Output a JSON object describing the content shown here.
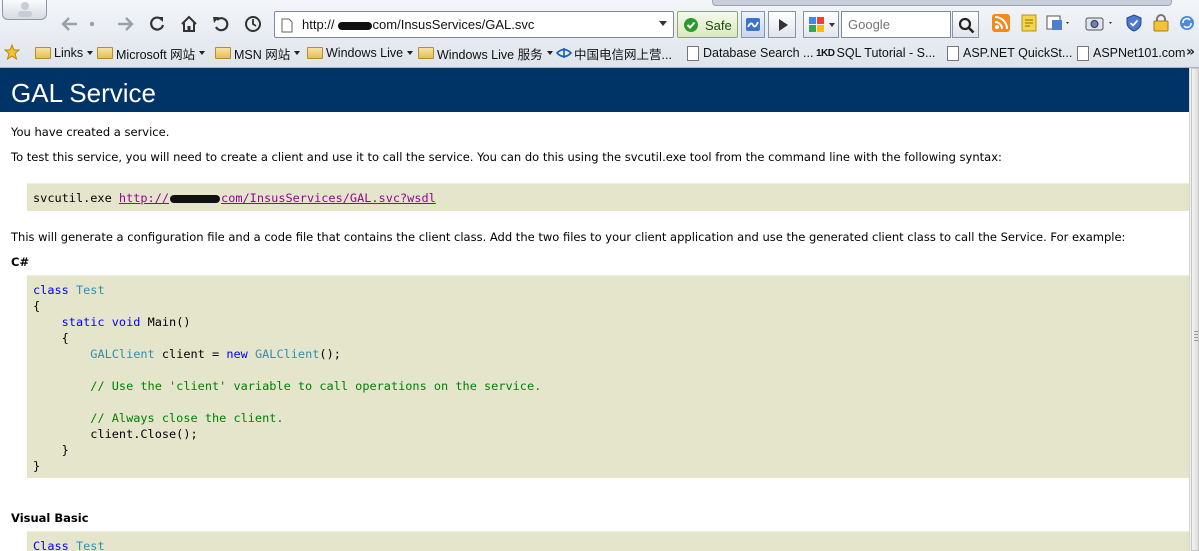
{
  "browser": {
    "address": {
      "prefix": "http://",
      "suffix": "com/InsusServices/GAL.svc"
    },
    "safe_label": "Safe",
    "search_placeholder": "Google",
    "favorites": [
      {
        "label": "Links",
        "kind": "folder",
        "dropdown": true
      },
      {
        "label": "Microsoft 网站",
        "kind": "folder",
        "dropdown": true
      },
      {
        "label": "MSN 网站",
        "kind": "folder",
        "dropdown": true
      },
      {
        "label": "Windows Live",
        "kind": "folder",
        "dropdown": true
      },
      {
        "label": "Windows Live 服务",
        "kind": "folder",
        "dropdown": true
      },
      {
        "label": "中国电信网上营...",
        "kind": "site",
        "dropdown": false
      },
      {
        "label": "Database Search ...",
        "kind": "page",
        "dropdown": false
      },
      {
        "label": "SQL Tutorial - S...",
        "kind": "site-1kd",
        "dropdown": false
      },
      {
        "label": "ASP.NET QuickSt...",
        "kind": "page",
        "dropdown": false
      },
      {
        "label": "ASPNet101.com",
        "kind": "page",
        "dropdown": false
      }
    ],
    "favicon_1kd": "1KD",
    "more_chevron": "»"
  },
  "page": {
    "title": "GAL Service",
    "intro": "You have created a service.",
    "instructions": "To test this service, you will need to create a client and use it to call the service. You can do this using the svcutil.exe tool from the command line with the following syntax:",
    "svcutil": {
      "command": "svcutil.exe",
      "url_prefix": "http://",
      "url_suffix": "com/InsusServices/GAL.svc?wsdl"
    },
    "generate_text": "This will generate a configuration file and a code file that contains the client class. Add the two files to your client application and use the generated client class to call the Service. For example:",
    "csharp_heading": "C#",
    "csharp_code": {
      "kw_class": "class",
      "class_name": "Test",
      "open_brace": "{",
      "kw_static": "static",
      "kw_void": "void",
      "main": "Main()",
      "inner_open": "{",
      "client_type": "GALClient",
      "client_decl": " client = ",
      "kw_new": "new",
      "client_ctor": "GALClient",
      "ctor_tail": "();",
      "comment_use": "// Use the 'client' variable to call operations on the service.",
      "comment_close": "// Always close the client.",
      "close_call": "client.Close();",
      "inner_close": "}",
      "close_brace": "}"
    },
    "vb_heading": "Visual Basic",
    "vb_code": {
      "kw_class": "Class",
      "class_name": "Test"
    }
  }
}
